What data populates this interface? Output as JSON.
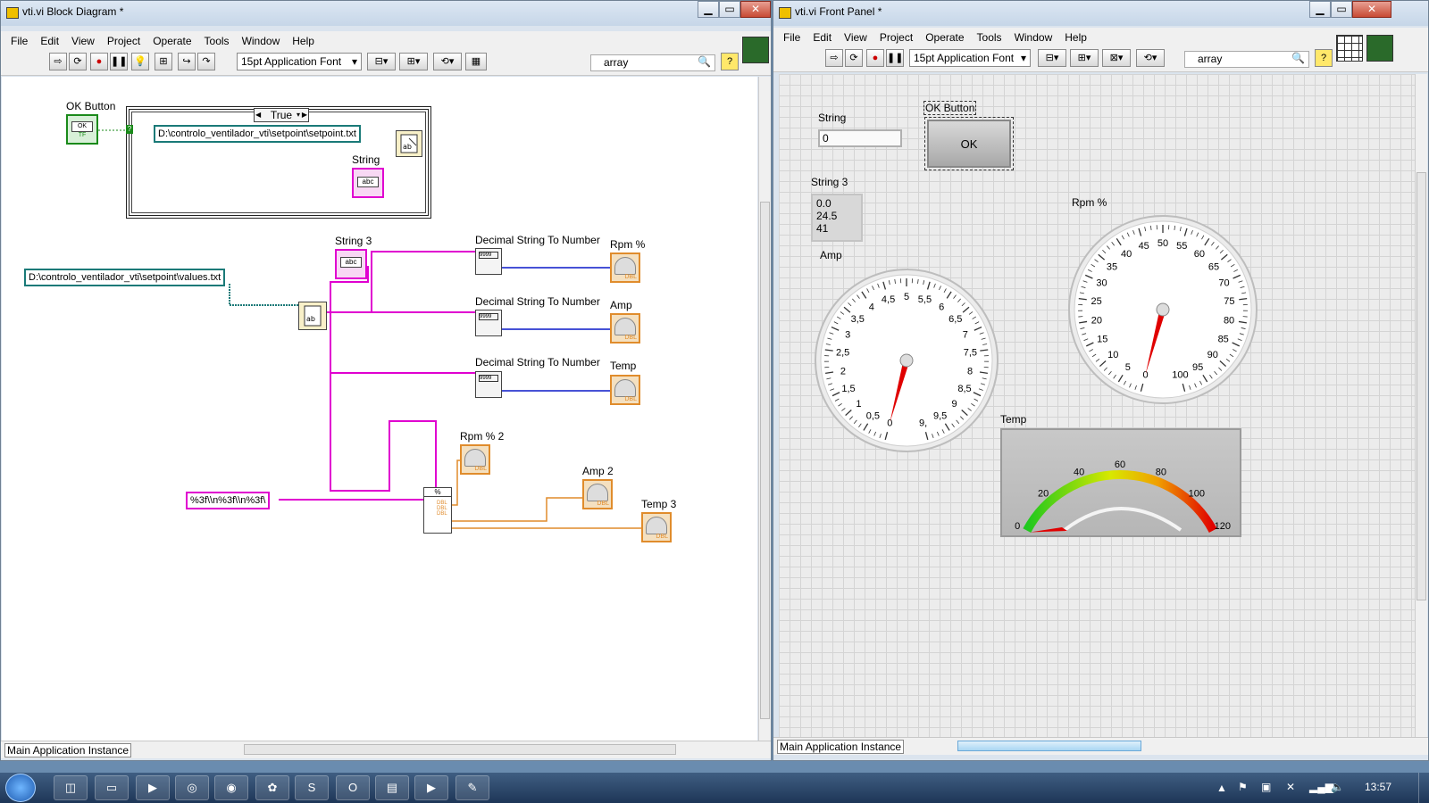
{
  "block_diagram": {
    "title": "vti.vi Block Diagram *",
    "menu": [
      "File",
      "Edit",
      "View",
      "Project",
      "Operate",
      "Tools",
      "Window",
      "Help"
    ],
    "font": "15pt Application Font",
    "search": "array",
    "status": "Main Application Instance",
    "case_selector": "True",
    "labels": {
      "ok_button": "OK Button",
      "string": "String",
      "string3": "String 3",
      "dstn": "Decimal String To Number",
      "rpm": "Rpm %",
      "amp": "Amp",
      "temp": "Temp",
      "rpm2": "Rpm % 2",
      "amp2": "Amp 2",
      "temp3": "Temp 3"
    },
    "path_setpoint": "D:\\controlo_ventilador_vti\\setpoint\\setpoint.txt",
    "path_values": "D:\\controlo_ventilador_vti\\setpoint\\values.txt",
    "format_string": "%3f\\\\n%3f\\\\n%3f\\",
    "ok_glyph": "OK",
    "tf_glyph": "TF",
    "abc_glyph": "abc",
    "dbl_glyph": "DBL"
  },
  "front_panel": {
    "title": "vti.vi Front Panel *",
    "menu": [
      "File",
      "Edit",
      "View",
      "Project",
      "Operate",
      "Tools",
      "Window",
      "Help"
    ],
    "font": "15pt Application Font",
    "search": "array",
    "status": "Main Application Instance",
    "string_label": "String",
    "string_value": "0",
    "ok_label": "OK Button",
    "ok_text": "OK",
    "string3_label": "String 3",
    "string3_lines": [
      "0.0",
      "24.5",
      "41"
    ],
    "amp": {
      "label": "Amp",
      "ticks": [
        "0",
        "0,5",
        "1",
        "1,5",
        "2",
        "2,5",
        "3",
        "3,5",
        "4",
        "4,5",
        "5",
        "5,5",
        "6",
        "6,5",
        "7",
        "7,5",
        "8",
        "8,5",
        "9",
        "9,5",
        "9,"
      ],
      "value": 0.0
    },
    "rpm": {
      "label": "Rpm %",
      "ticks": [
        "0",
        "5",
        "10",
        "15",
        "20",
        "25",
        "30",
        "35",
        "40",
        "45",
        "50",
        "55",
        "60",
        "65",
        "70",
        "75",
        "80",
        "85",
        "90",
        "95",
        "100"
      ],
      "value": 0
    },
    "temp": {
      "label": "Temp",
      "ticks": [
        "0",
        "20",
        "40",
        "60",
        "80",
        "100",
        "120"
      ],
      "value": 0
    }
  },
  "taskbar": {
    "clock": "13:57",
    "apps": [
      "LV",
      "Folder",
      "Media",
      "Norton",
      "Chrome",
      "Flower",
      "Skype",
      "Office",
      "Task",
      "LV2",
      "Edit"
    ]
  },
  "colors": {
    "wire_pink": "#e000d0",
    "wire_blue": "#0a18c8",
    "wire_orange": "#e08c2c",
    "wire_teal": "#1a7a78",
    "wire_green": "#1a8a1a",
    "needle": "#e00000"
  }
}
